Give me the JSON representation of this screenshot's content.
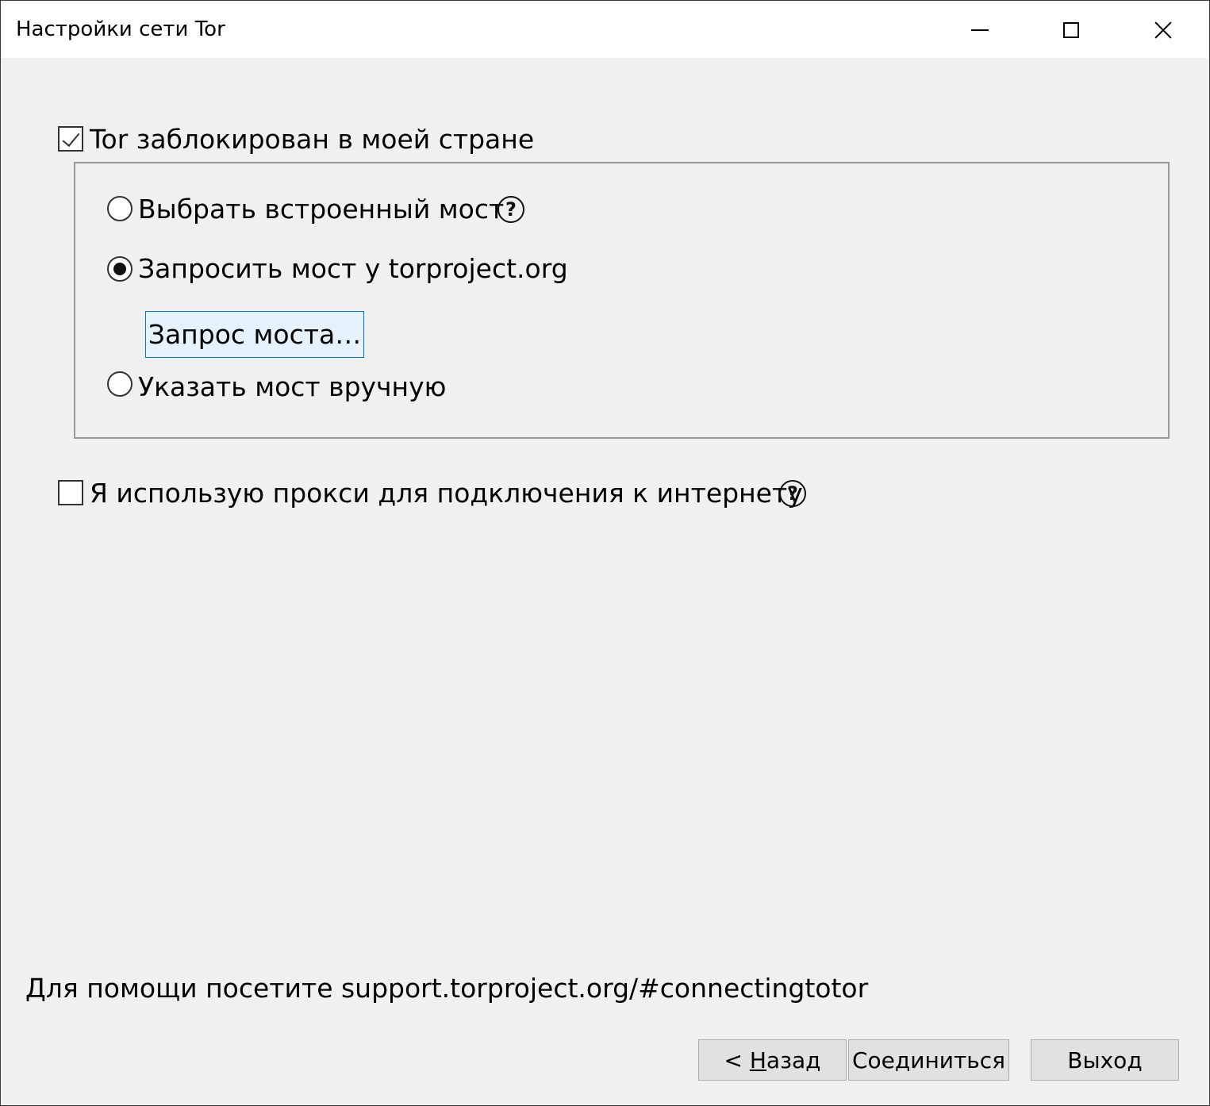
{
  "window": {
    "title": "Настройки сети Tor"
  },
  "bridges": {
    "blocked_checkbox_label": "Tor заблокирован в моей стране",
    "blocked_checked": true,
    "option_builtin_label": "Выбрать встроенный мост",
    "option_request_label": "Запросить мост у torproject.org",
    "option_manual_label": "Указать мост вручную",
    "selected_option": "request",
    "request_button_label": "Запрос моста…"
  },
  "proxy": {
    "checkbox_label": "Я использую прокси для подключения к интернету",
    "checked": false
  },
  "help_icon_glyph": "?",
  "footer": {
    "help_text": "Для помощи посетите support.torproject.org/#connectingtotor",
    "back_prefix": "< ",
    "back_mnemonic": "Н",
    "back_rest": "азад",
    "connect_label": "Соединиться",
    "exit_label": "Выход"
  }
}
